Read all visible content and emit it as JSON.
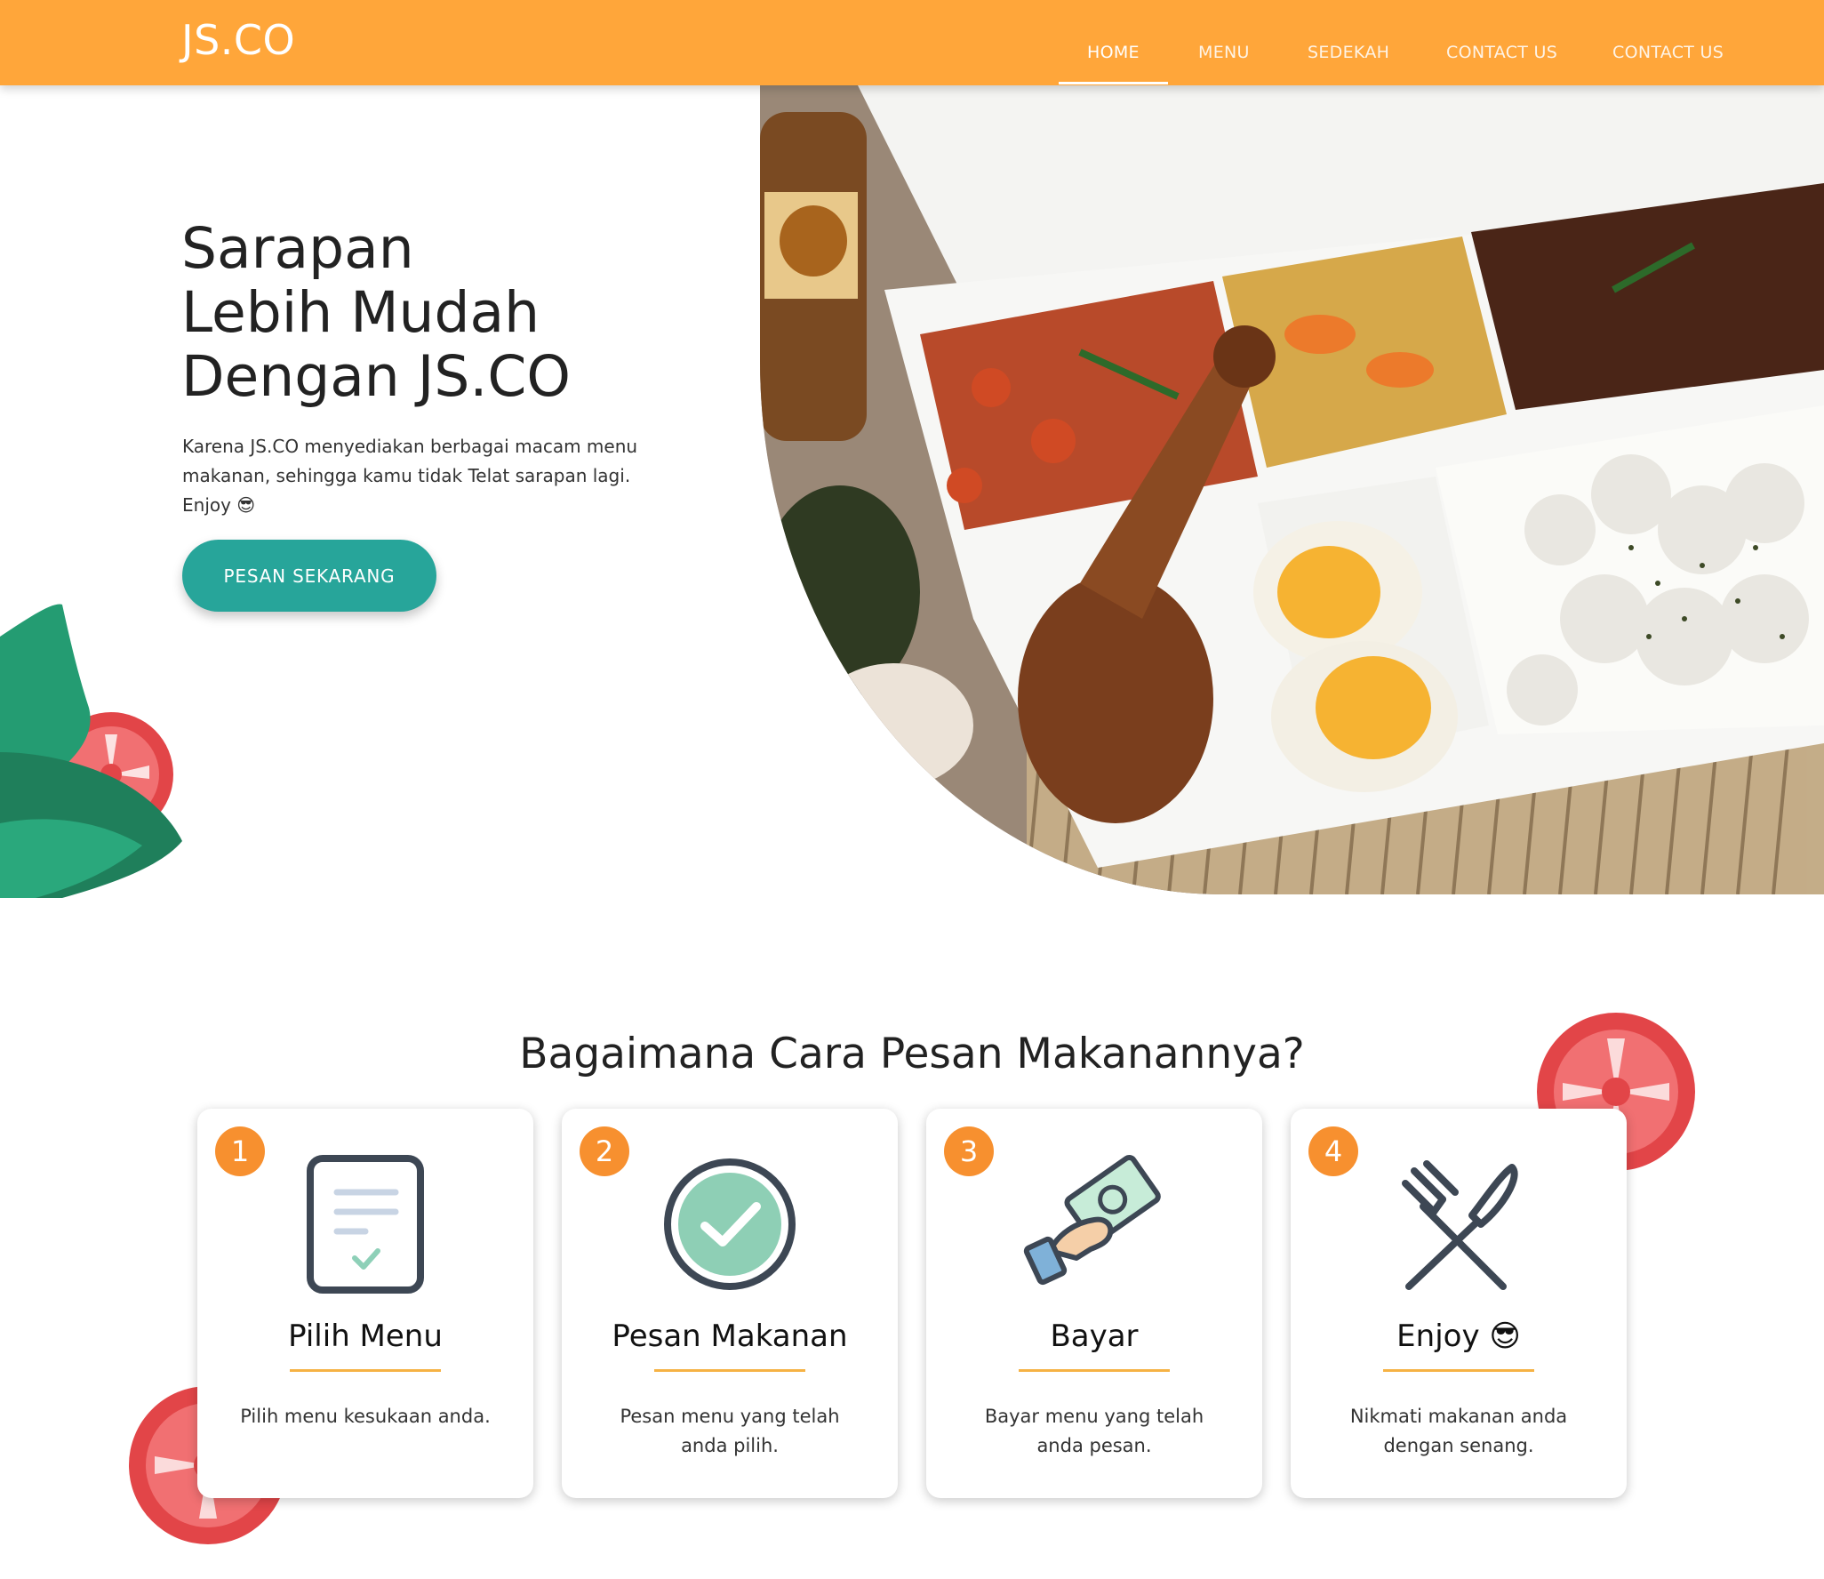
{
  "navbar": {
    "brand": "JS.CO",
    "items": [
      "HOME",
      "MENU",
      "SEDEKAH",
      "CONTACT US",
      "CONTACT US"
    ]
  },
  "hero": {
    "title_lines": [
      "Sarapan",
      "Lebih Mudah",
      "Dengan JS.CO"
    ],
    "description": "Karena JS.CO menyediakan berbagai macam menu makanan, sehingga kamu tidak Telat sarapan lagi. Enjoy 😎",
    "cta_label": "PESAN SEKARANG"
  },
  "steps_section": {
    "title": "Bagaimana Cara Pesan Makanannya?",
    "steps": [
      {
        "number": "1",
        "title": "Pilih Menu",
        "description": "Pilih menu kesukaan anda.",
        "icon": "menu-document-icon"
      },
      {
        "number": "2",
        "title": "Pesan Makanan",
        "description": "Pesan menu yang telah anda pilih.",
        "icon": "check-circle-icon"
      },
      {
        "number": "3",
        "title": "Bayar",
        "description": "Bayar menu yang telah anda pesan.",
        "icon": "hand-money-icon"
      },
      {
        "number": "4",
        "title": "Enjoy 😎",
        "description": "Nikmati makanan anda dengan senang.",
        "icon": "fork-knife-icon"
      }
    ]
  },
  "colors": {
    "navbar": "#ffa63a",
    "cta": "#27a59a",
    "badge": "#f7902f",
    "title_underline": "#f6b244"
  }
}
